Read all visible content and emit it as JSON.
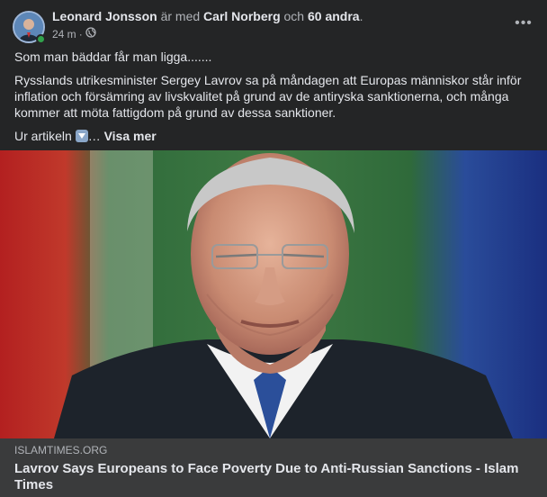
{
  "post": {
    "author": "Leonard Jonsson",
    "with_text": "är med",
    "tagged_person": "Carl Norberg",
    "conjunction": "och",
    "others": "60 andra",
    "period": ".",
    "timestamp": "24 m",
    "separator": "·",
    "audience_icon": "globe-icon",
    "more_icon": "more-horizontal-icon",
    "more_label": "•••",
    "text": {
      "line1": "Som man bäddar får man ligga.......",
      "paragraph": "Rysslands utrikesminister Sergey Lavrov sa på måndagen att Europas människor står inför inflation och försämring av livskvalitet på grund av de antiryska sanktionerna, och många kommer att möta fattigdom på grund av dessa sanktioner.",
      "source_prefix": "Ur artikeln",
      "source_emoji": "down-arrow-emoji",
      "ellipsis": "…",
      "see_more": "Visa mer"
    },
    "link": {
      "domain": "ISLAMTIMES.ORG",
      "title": "Lavrov Says Europeans to Face Poverty Due to Anti-Russian Sanctions - Islam Times"
    }
  },
  "colors": {
    "card_bg": "#242526",
    "footer_bg": "#3a3b3c",
    "text_primary": "#e4e6eb",
    "text_secondary": "#b0b3b8",
    "online": "#31a24c"
  }
}
